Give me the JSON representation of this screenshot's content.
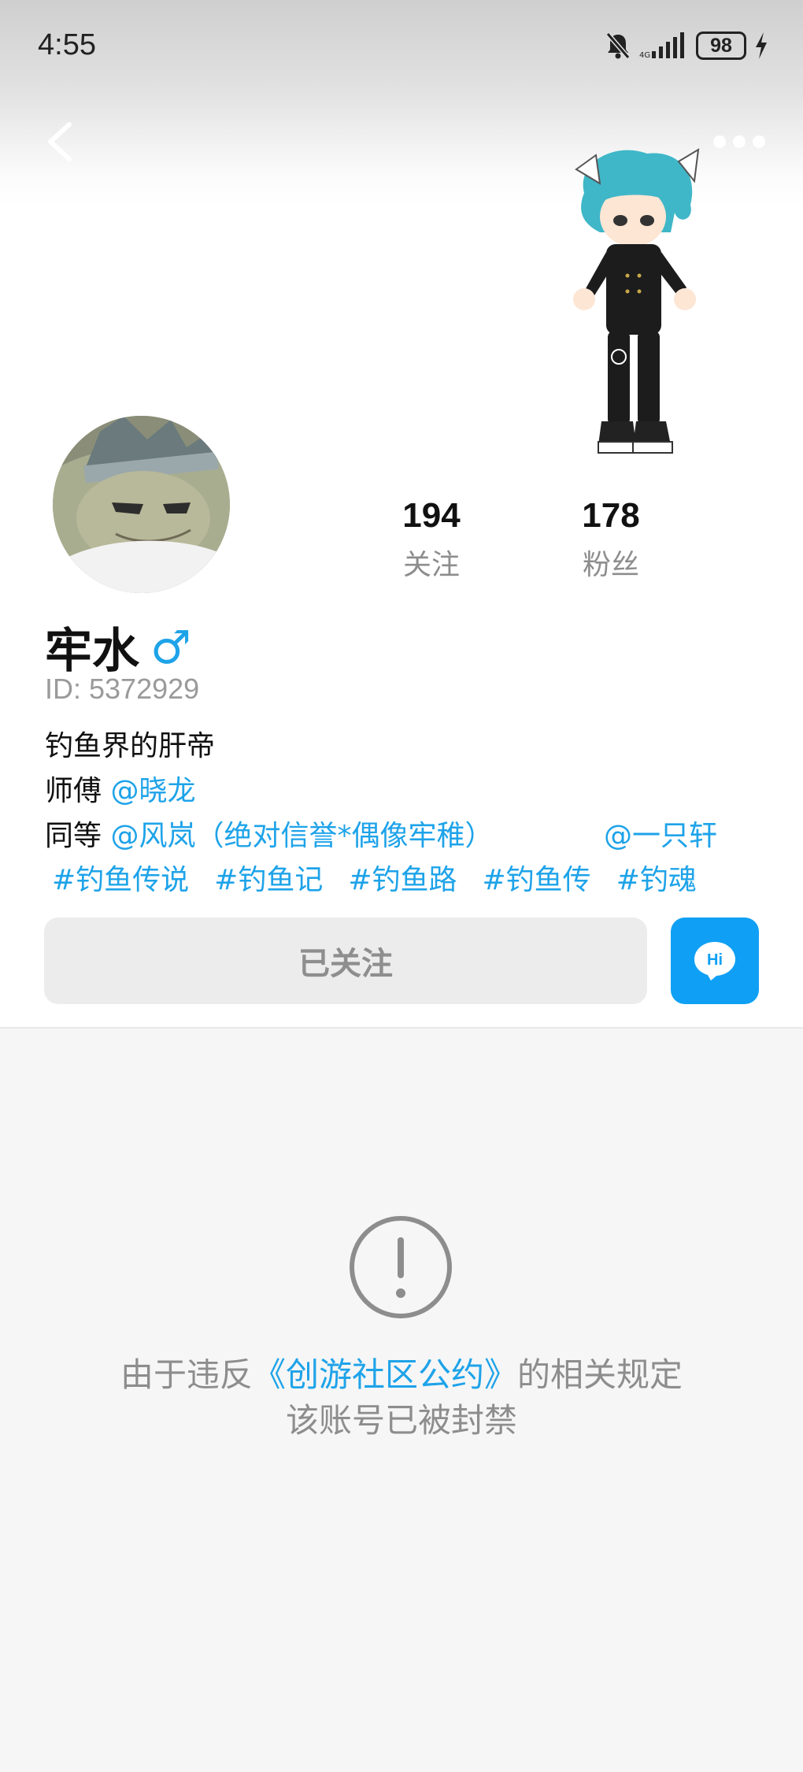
{
  "status_bar": {
    "time": "4:55",
    "battery": "98"
  },
  "profile": {
    "name": "牢水",
    "gender_symbol": "♂",
    "id_text": "ID: 5372929",
    "stats": [
      {
        "value": "194",
        "label": "关注"
      },
      {
        "value": "178",
        "label": "粉丝"
      }
    ],
    "bio": {
      "line1": "钓鱼界的肝帝",
      "line2_prefix": "师傅 ",
      "line2_mention": "@晓龙",
      "line3_prefix": "同等 ",
      "line3_mention1": "@风岚（绝对信誉*偶像牢稚）",
      "line3_mention2": "@一只轩"
    },
    "tags": [
      "#钓鱼传说",
      "#钓鱼记",
      "#钓鱼路",
      "#钓鱼传",
      "#钓魂"
    ]
  },
  "actions": {
    "follow_label": "已关注",
    "hi_label": "Hi"
  },
  "ban_notice": {
    "line1_prefix": "由于违反",
    "link": "《创游社区公约》",
    "line1_suffix": "的相关规定",
    "line2": "该账号已被封禁"
  },
  "colors": {
    "accent": "#1ea3e9",
    "hi_button": "#0fa0f5"
  },
  "icons": [
    "back-icon",
    "more-icon",
    "mute-bell-icon",
    "signal-icon",
    "battery-icon",
    "charging-icon",
    "chat-bubble-icon",
    "exclamation-icon"
  ]
}
